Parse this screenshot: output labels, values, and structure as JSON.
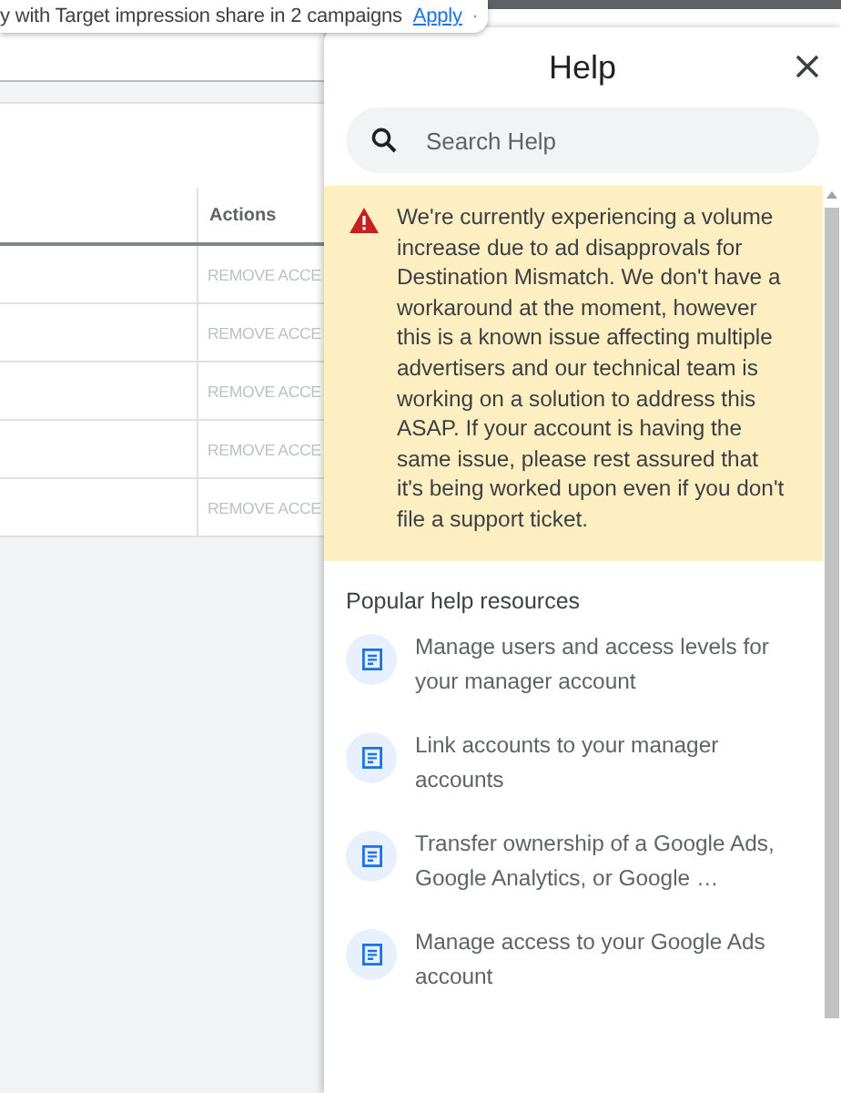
{
  "banner": {
    "text": "y with Target impression share in 2 campaigns",
    "action": "Apply"
  },
  "table": {
    "columns": [
      "Actions"
    ],
    "rows": [
      {
        "action": "REMOVE ACCE",
        "disabled": true
      },
      {
        "action": "REMOVE ACCE",
        "disabled": true
      },
      {
        "action": "REMOVE ACCE",
        "disabled": true
      },
      {
        "action": "REMOVE ACCE",
        "disabled": true
      },
      {
        "action": "REMOVE ACCE",
        "disabled": true
      }
    ]
  },
  "help": {
    "title": "Help",
    "search": {
      "placeholder": "Search Help"
    },
    "alert": {
      "text": "We're currently experiencing a volume increase due to ad disapprovals for Destination Mismatch. We don't have a workaround at the moment, however this is a known issue affecting multiple advertisers and our technical team is working on a solution to address this ASAP. If your account is having the same issue, please rest assured that it's being worked upon even if you don't file a support ticket."
    },
    "section_title": "Popular help resources",
    "resources": [
      "Manage users and access levels for your manager account",
      "Link accounts to your manager accounts",
      "Transfer ownership of a Google Ads, Google Analytics, or Google …",
      "Manage access to your Google Ads account"
    ]
  }
}
